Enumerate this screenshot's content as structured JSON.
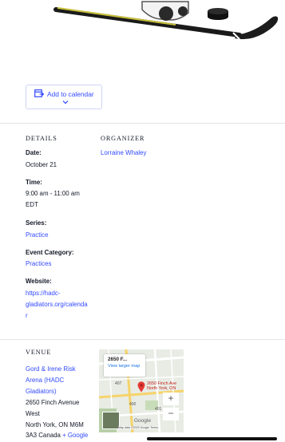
{
  "add_to_calendar": {
    "label": "Add to calendar"
  },
  "details": {
    "heading": "DETAILS",
    "date_label": "Date:",
    "date_value": "October 21",
    "time_label": "Time:",
    "time_value_line1": "9:00 am - 11:00 am",
    "time_value_line2": "EDT",
    "series_label": "Series:",
    "series_value": "Practice",
    "category_label": "Event Category:",
    "category_value": "Practices",
    "website_label": "Website:",
    "website_lines": [
      "https://hadc-",
      "gladiators.org/calenda",
      "r"
    ]
  },
  "organizer": {
    "heading": "ORGANIZER",
    "name": "Lorraine Whaley"
  },
  "venue": {
    "heading": "VENUE",
    "name_lines": [
      "Gord & Irene Risk",
      "Arena (HADC",
      "Gladiators)"
    ],
    "address_lines": [
      "2650 Finch Avenue",
      "West",
      "North York, ON M6M"
    ],
    "postal_country": "3A3 Canada",
    "google_link": "+ Google"
  },
  "map": {
    "card_title": "2650 F...",
    "card_link": "View larger map",
    "pin_label_line1": "2650 Finch Ave",
    "pin_label_line2": "North York, ON",
    "road_labels": [
      "407",
      "400",
      "401"
    ],
    "zoom_in": "+",
    "zoom_out": "−",
    "logo": "Google",
    "attribution": "Map data ©2023 Google   Terms"
  },
  "colors": {
    "link": "#334aff",
    "text": "#141827",
    "map_pin": "#e53935"
  }
}
